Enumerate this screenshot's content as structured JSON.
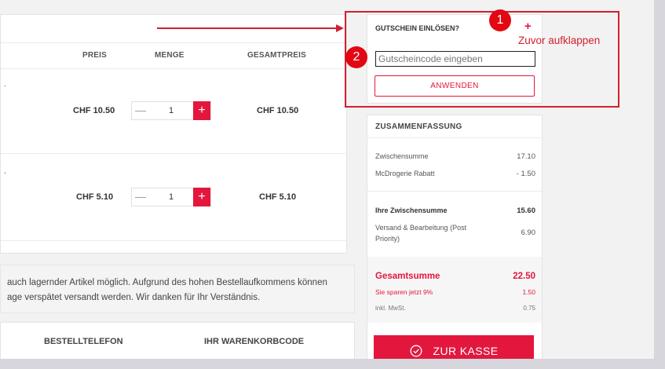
{
  "cart": {
    "headers": {
      "price": "PREIS",
      "quantity": "MENGE",
      "total": "GESAMTPREIS"
    },
    "rows": [
      {
        "price": "CHF 10.50",
        "quantity": "1",
        "total": "CHF 10.50"
      },
      {
        "price": "CHF 5.10",
        "quantity": "1",
        "total": "CHF 5.10"
      }
    ]
  },
  "notice": {
    "line1": "auch lagernder Artikel möglich. Aufgrund des hohen Bestellaufkommens können",
    "line2": "age verspätet versandt werden. Wir danken für Ihr Verständnis."
  },
  "bottom": {
    "phone": "BESTELLTELEFON",
    "cart_code": "IHR WARENKORBCODE"
  },
  "voucher": {
    "title": "GUTSCHEIN EINLÖSEN?",
    "expand": "+",
    "placeholder": "Gutscheincode eingeben",
    "apply": "ANWENDEN"
  },
  "summary": {
    "title": "ZUSAMMENFASSUNG",
    "subtotal_label": "Zwischensumme",
    "subtotal": "17.10",
    "discount_label": "McDrogerie Rabatt",
    "discount": "- 1.50",
    "your_subtotal_label": "Ihre Zwischensumme",
    "your_subtotal": "15.60",
    "shipping_label_1": "Versand & Bearbeitung (Post",
    "shipping_label_2": "Priority)",
    "shipping": "6.90",
    "total_label": "Gesamtsumme",
    "total": "22.50",
    "savings_label": "Sie sparen jetzt 9%",
    "savings": "1.50",
    "vat_label": "inkl. MwSt.",
    "vat": "0.75",
    "checkout": "ZUR KASSE"
  },
  "annotation": {
    "step1": "1",
    "step2": "2",
    "hint": "Zuvor aufklappen"
  },
  "colors": {
    "accent": "#e3173e",
    "annotation": "#d21f2f"
  }
}
